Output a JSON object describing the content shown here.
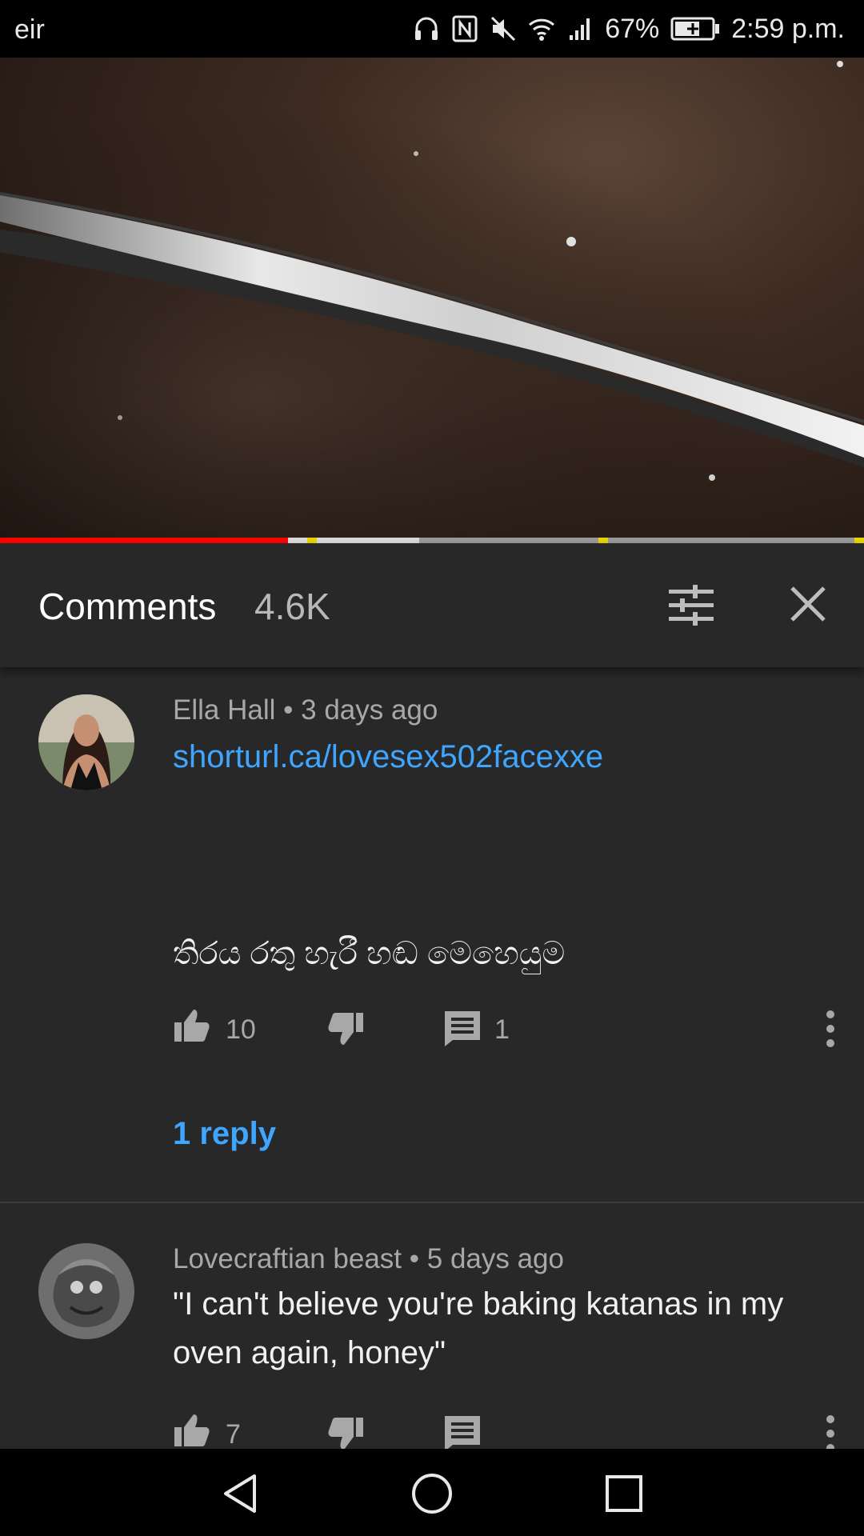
{
  "status_bar": {
    "carrier": "eir",
    "battery_percent": "67%",
    "time": "2:59 p.m.",
    "icons": [
      "headphones-icon",
      "nfc-icon",
      "mute-icon",
      "wifi-icon",
      "signal-icon",
      "battery-charging-icon"
    ]
  },
  "video": {
    "progress_played_fraction": 0.333,
    "progress_buffered_fraction": 0.485,
    "colors": {
      "played": "#ff0000",
      "buffered": "#d9d9d9",
      "track": "#9a9a9a",
      "chapter_marker": "#e6d400"
    }
  },
  "comments_header": {
    "title": "Comments",
    "count": "4.6K",
    "sort_icon": "sort-filter-icon",
    "close_icon": "close-icon"
  },
  "comments": [
    {
      "author": "Ella Hall",
      "separator": "•",
      "time": "3 days ago",
      "link": "shorturl.ca/lovesex502facexxe",
      "text": "තිරය රතු හැරී හඬ මෙහෙයුම",
      "likes": "10",
      "reply_count": "1",
      "replies_label": "1 reply"
    },
    {
      "author": "Lovecraftian beast",
      "separator": "•",
      "time": "5 days ago",
      "text": "\"I can't believe you're baking katanas in my oven again, honey\"",
      "likes": "7"
    }
  ],
  "colors": {
    "background": "#282828",
    "link": "#3ea6ff",
    "secondary_text": "#a8a8a8"
  }
}
